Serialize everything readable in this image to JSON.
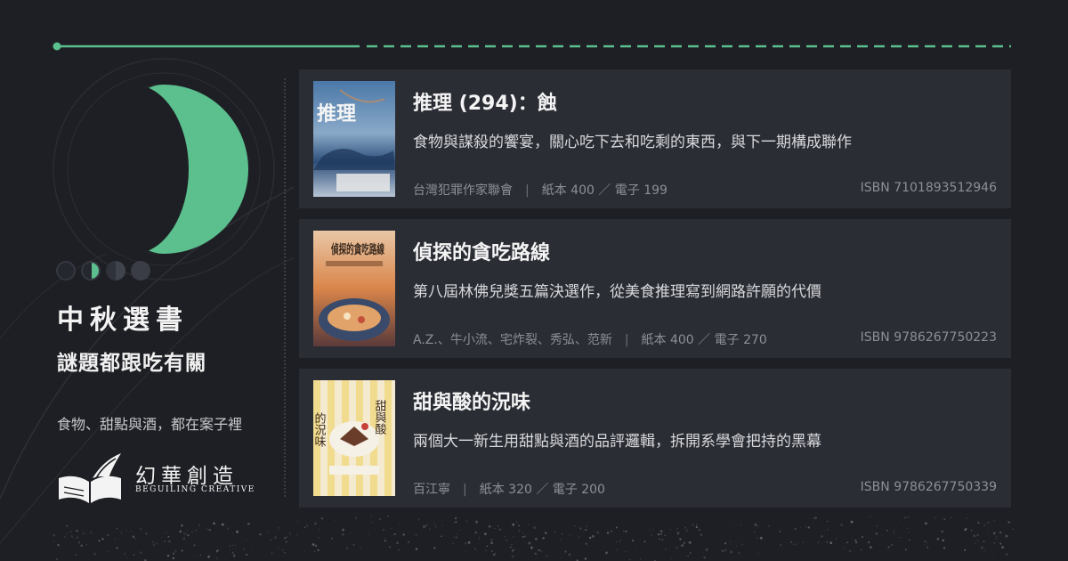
{
  "header": {
    "accent_color": "#5bbf8e"
  },
  "left_panel": {
    "title": "中秋選書",
    "subtitle": "謎題都跟吃有關",
    "tagline": "食物、甜點與酒，都在案子裡",
    "logo": {
      "name_zh": "幻華創造",
      "name_en": "BEGUILING CREATIVE"
    }
  },
  "books": [
    {
      "title": "推理 (294)：蝕",
      "description": "食物與謀殺的饗宴，關心吃下去和吃剩的東西，與下一期構成聯作",
      "authors": "台灣犯罪作家聯會",
      "formats": "紙本 400 ／ 電子 199",
      "isbn": "ISBN 7101893512946",
      "cover_text": "推理"
    },
    {
      "title": "偵探的貪吃路線",
      "description": "第八屆林佛兒獎五篇決選作，從美食推理寫到網路許願的代價",
      "authors": "A.Z.、牛小流、宅炸裂、秀弘、范新",
      "formats": "紙本 400 ／ 電子 270",
      "isbn": "ISBN 9786267750223",
      "cover_text": "偵探的貪吃路線"
    },
    {
      "title": "甜與酸的況味",
      "description": "兩個大一新生用甜點與酒的品評邏輯，拆開系學會把持的黑幕",
      "authors": "百江寧",
      "formats": "紙本 320 ／ 電子 200",
      "isbn": "ISBN 9786267750339",
      "cover_text_a": "甜與酸",
      "cover_text_b": "的況味"
    }
  ]
}
